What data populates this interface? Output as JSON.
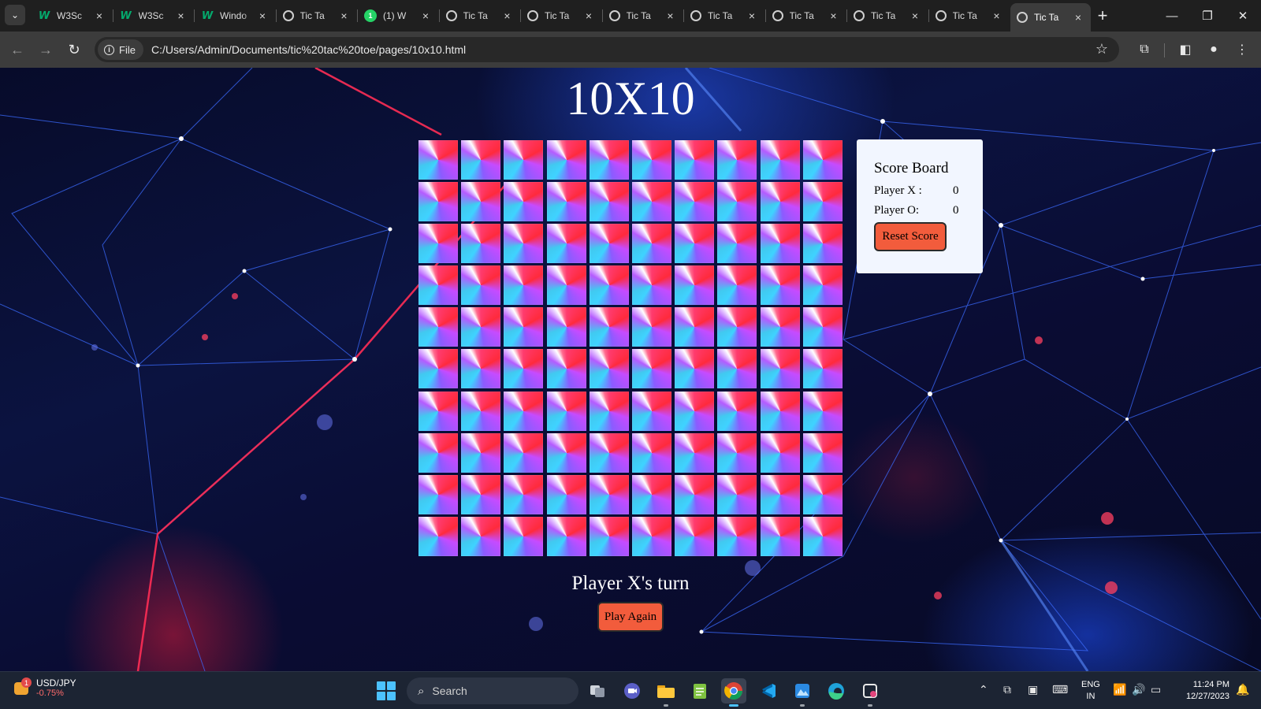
{
  "browser": {
    "tabs": [
      {
        "label": "W3Sc",
        "icon": "w3schools-icon"
      },
      {
        "label": "W3Sc",
        "icon": "w3schools-icon"
      },
      {
        "label": "Windo",
        "icon": "w3schools-icon"
      },
      {
        "label": "Tic Ta",
        "icon": "globe-icon"
      },
      {
        "label": "(1) W",
        "icon": "whatsapp-icon",
        "badge": "1"
      },
      {
        "label": "Tic Ta",
        "icon": "globe-icon"
      },
      {
        "label": "Tic Ta",
        "icon": "globe-icon"
      },
      {
        "label": "Tic Ta",
        "icon": "globe-icon"
      },
      {
        "label": "Tic Ta",
        "icon": "globe-icon"
      },
      {
        "label": "Tic Ta",
        "icon": "globe-icon"
      },
      {
        "label": "Tic Ta",
        "icon": "globe-icon"
      },
      {
        "label": "Tic Ta",
        "icon": "globe-icon"
      },
      {
        "label": "Tic Ta",
        "icon": "globe-icon",
        "active": true
      }
    ],
    "site_chip": "File",
    "url": "C:/Users/Admin/Documents/tic%20tac%20toe/pages/10x10.html"
  },
  "game": {
    "title": "10X10",
    "grid": {
      "rows": 10,
      "cols": 10
    },
    "turn_text": "Player X's turn",
    "play_again_label": "Play Again"
  },
  "scoreboard": {
    "title": "Score Board",
    "player_x_label": "Player X :",
    "player_x_score": "0",
    "player_o_label": "Player O:",
    "player_o_score": "0",
    "reset_label": "Reset Score"
  },
  "taskbar": {
    "widget_badge": "1",
    "widget_symbol": "USD/JPY",
    "widget_change": "-0.75%",
    "search_placeholder": "Search",
    "lang_top": "ENG",
    "lang_bottom": "IN",
    "time": "11:24 PM",
    "date": "12/27/2023"
  },
  "colors": {
    "button_accent": "#f25c3c",
    "scoreboard_bg": "#f2f6ff",
    "windows_accent": "#4cc2ff"
  }
}
